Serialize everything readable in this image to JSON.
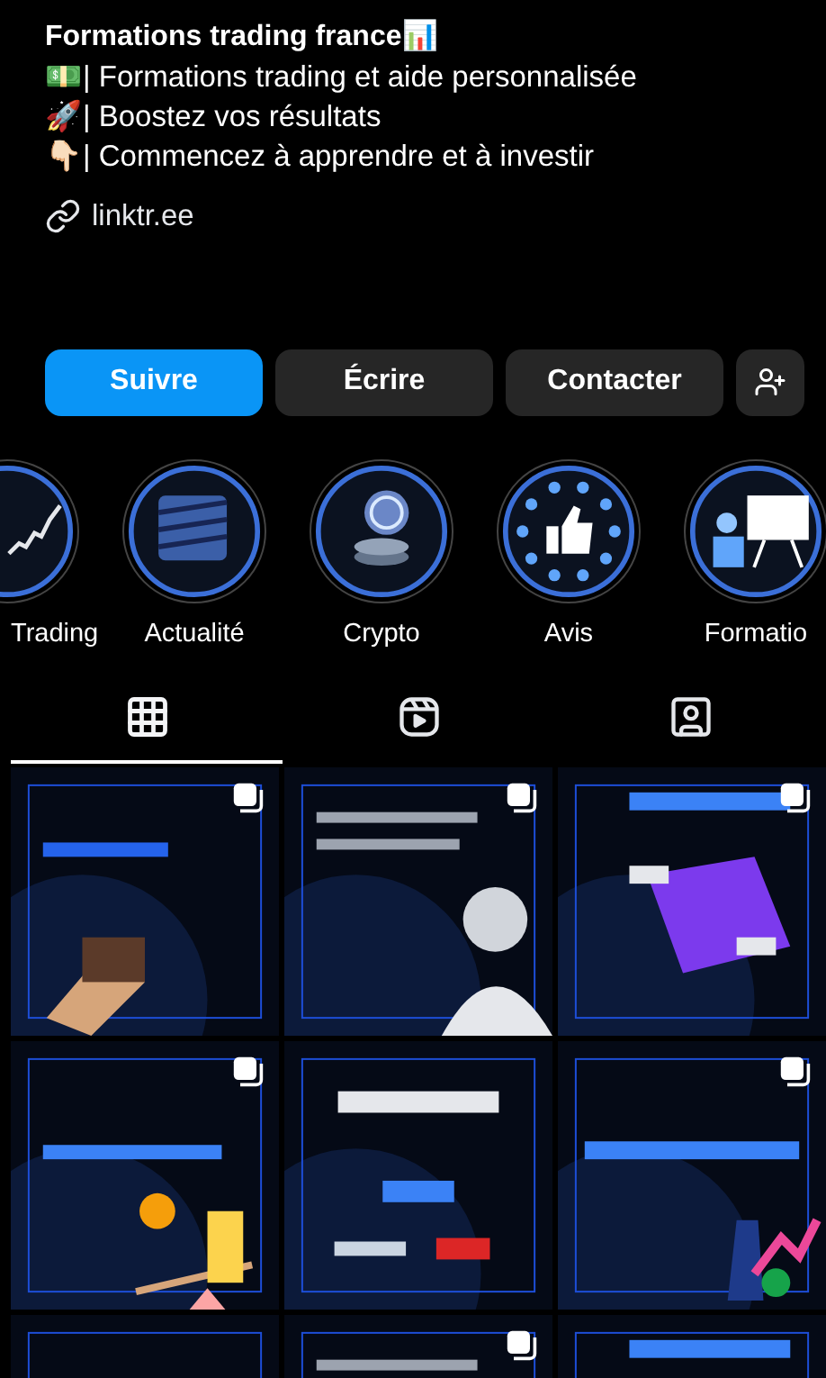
{
  "profile": {
    "name": "Formations trading france📊",
    "bio": [
      "💵| Formations trading et aide personnalisée",
      "🚀| Boostez vos résultats",
      "👇🏻| Commencez à apprendre et à investir"
    ],
    "link": "linktr.ee"
  },
  "actions": [
    {
      "kind": "primary",
      "label": "Suivre"
    },
    {
      "kind": "secondary",
      "label": "Écrire"
    },
    {
      "kind": "secondary",
      "label": "Contacter"
    },
    {
      "kind": "add_person"
    }
  ],
  "highlights": [
    {
      "label": "Trading"
    },
    {
      "label": "Actualité"
    },
    {
      "label": "Crypto"
    },
    {
      "label": "Avis"
    },
    {
      "label": "Formatio"
    }
  ],
  "tabs": [
    {
      "kind": "grid",
      "selected": true
    },
    {
      "kind": "reels",
      "selected": false
    },
    {
      "kind": "tagged",
      "selected": false
    }
  ],
  "posts": [
    {
      "kind": "picture",
      "multiple": true
    },
    {
      "kind": "picture",
      "multiple": true
    },
    {
      "kind": "picture",
      "multiple": true
    },
    {
      "kind": "picture",
      "multiple": true
    },
    {
      "kind": "picture",
      "multiple": false
    },
    {
      "kind": "picture",
      "multiple": true
    },
    {
      "kind": "picture",
      "multiple": false
    },
    {
      "kind": "picture",
      "multiple": true
    },
    {
      "kind": "picture",
      "multiple": false
    }
  ]
}
